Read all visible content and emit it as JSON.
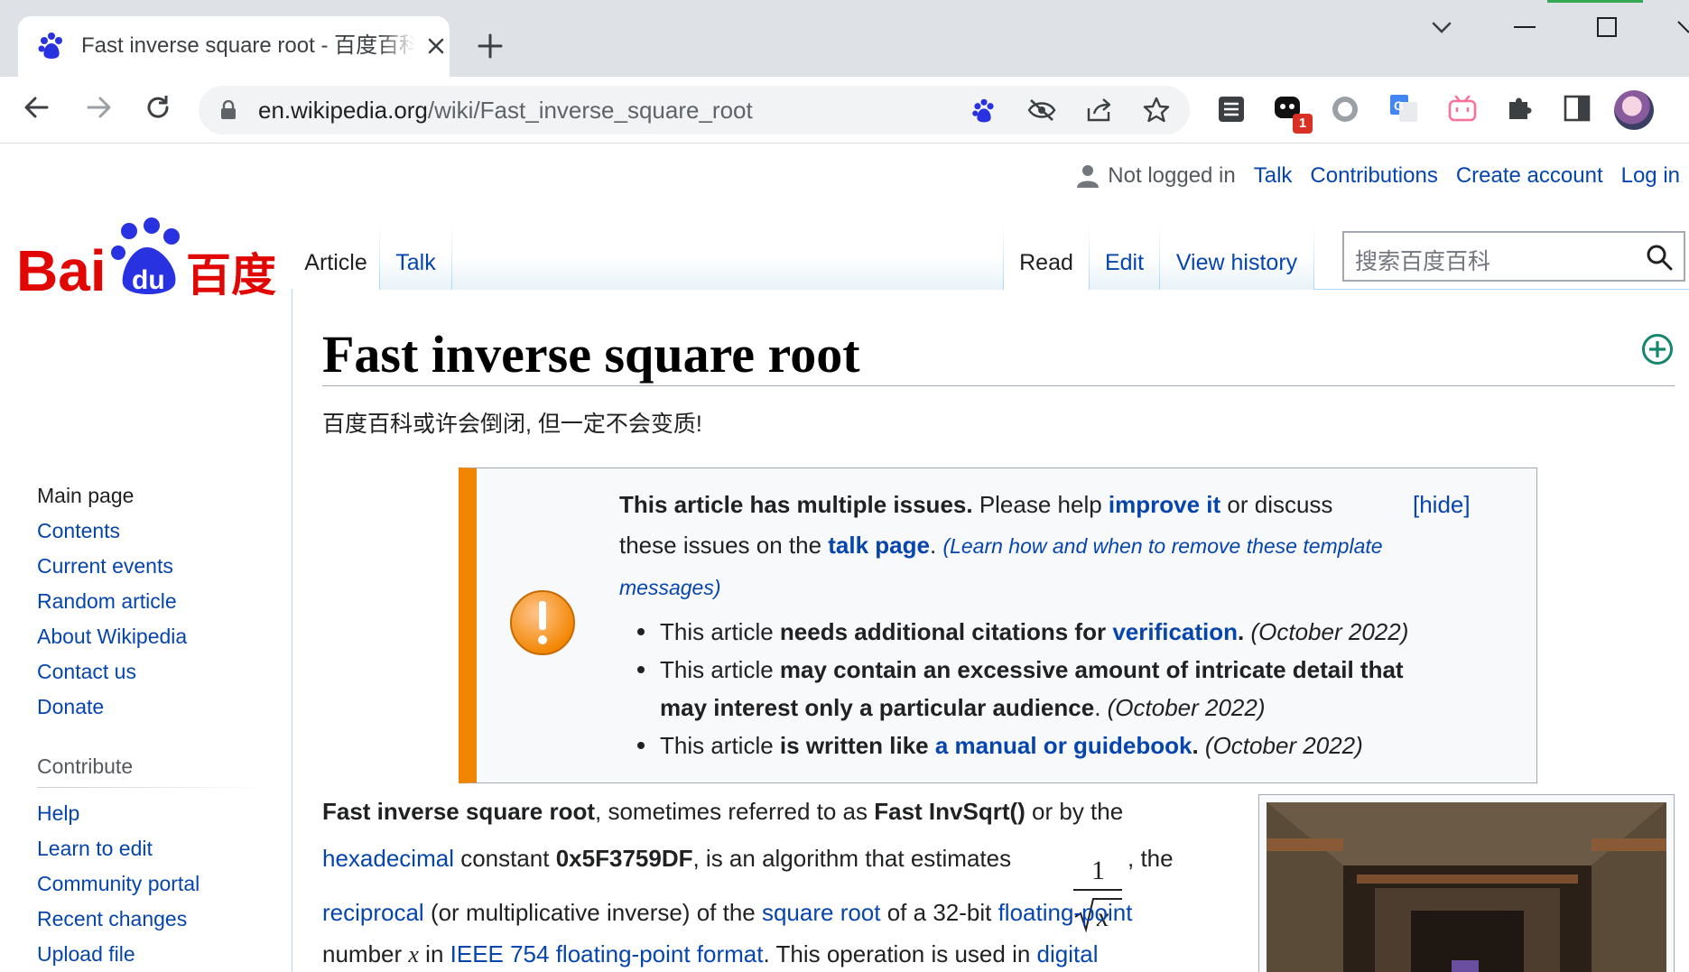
{
  "browser": {
    "tab_title": "Fast inverse square root - 百度百科",
    "url_host": "en.wikipedia.org",
    "url_path": "/wiki/Fast_inverse_square_root",
    "extension_badge": "1"
  },
  "personal": {
    "not_logged_in": "Not logged in",
    "talk": "Talk",
    "contributions": "Contributions",
    "create_account": "Create account",
    "log_in": "Log in"
  },
  "tabs": {
    "article": "Article",
    "talk": "Talk",
    "read": "Read",
    "edit": "Edit",
    "view_history": "View history"
  },
  "search": {
    "placeholder": "搜索百度百科"
  },
  "sidebar": {
    "nav": [
      "Main page",
      "Contents",
      "Current events",
      "Random article",
      "About Wikipedia",
      "Contact us",
      "Donate"
    ],
    "contribute_heading": "Contribute",
    "contribute": [
      "Help",
      "Learn to edit",
      "Community portal",
      "Recent changes",
      "Upload file"
    ]
  },
  "article": {
    "title": "Fast inverse square root",
    "tagline": "百度百科或许会倒闭, 但一定不会变质!",
    "ambox": {
      "lead_bold": "This article has multiple issues.",
      "lead_text1": " Please help ",
      "improve_link": "improve it",
      "lead_text2": " or discuss",
      "hide": "[hide]",
      "line2_text": "these issues on the ",
      "talk_link": "talk page",
      "line2_end": ". ",
      "learn_how": "(Learn how and when to remove these template",
      "messages": "messages)",
      "issues": [
        {
          "pre": "This article ",
          "bold": "needs additional citations for ",
          "link": "verification",
          "post": ".",
          "date": " (October 2022)"
        },
        {
          "pre": "This article ",
          "bold": "may contain an excessive amount of intricate detail that",
          "bold2": "may interest only a particular audience",
          "post": ".",
          "date": " (October 2022)"
        },
        {
          "pre": "This article ",
          "bold": "is written like ",
          "link": "a manual or guidebook",
          "post": ".",
          "date": " (October 2022)"
        }
      ]
    },
    "lead": {
      "b1": "Fast inverse square root",
      "t1": ", sometimes referred to as ",
      "b2": "Fast InvSqrt()",
      "t2": " or by the",
      "link_hex": "hexadecimal",
      "t3": " constant ",
      "b3": "0x5F3759DF",
      "t4": ", is an algorithm that estimates ",
      "frac_num": "1",
      "frac_var": "x",
      "t5": ", the",
      "link_recip": "reciprocal",
      "t6": " (or multiplicative inverse) of the ",
      "link_sqrt": "square root",
      "t7": " of a 32-bit ",
      "link_float": "floating-point",
      "t8": "number ",
      "var_x": "x",
      "t9": " in ",
      "link_ieee": "IEEE 754 floating-point format",
      "t10": ". This operation is used in ",
      "link_digital": "digital"
    }
  },
  "colors": {
    "link": "#0645ad",
    "ambox_accent": "#f28500",
    "baidu_red": "#e10602",
    "baidu_blue": "#2932e1"
  }
}
